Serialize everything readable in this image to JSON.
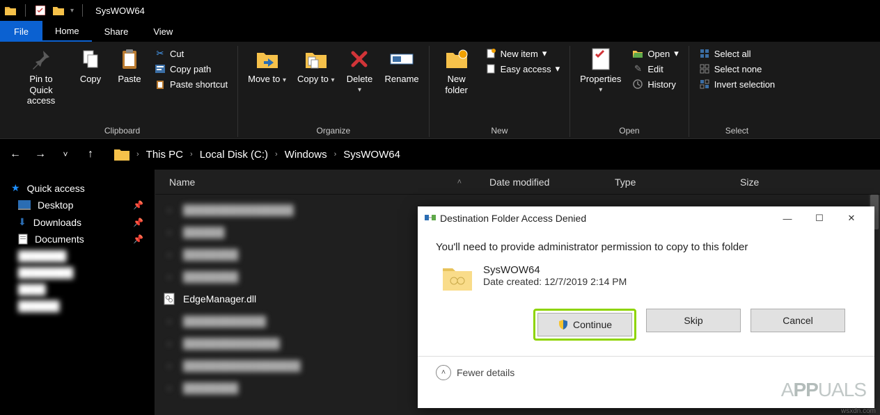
{
  "titlebar": {
    "title": "SysWOW64"
  },
  "menu": {
    "file": "File",
    "home": "Home",
    "share": "Share",
    "view": "View"
  },
  "ribbon": {
    "clipboard": {
      "label": "Clipboard",
      "pin": "Pin to Quick access",
      "copy": "Copy",
      "paste": "Paste",
      "cut": "Cut",
      "copypath": "Copy path",
      "pasteshortcut": "Paste shortcut"
    },
    "organize": {
      "label": "Organize",
      "moveto": "Move to",
      "copyto": "Copy to",
      "delete": "Delete",
      "rename": "Rename"
    },
    "new": {
      "label": "New",
      "newfolder": "New folder",
      "newitem": "New item",
      "easyaccess": "Easy access"
    },
    "open": {
      "label": "Open",
      "properties": "Properties",
      "open": "Open",
      "edit": "Edit",
      "history": "History"
    },
    "select": {
      "label": "Select",
      "all": "Select all",
      "none": "Select none",
      "invert": "Invert selection"
    }
  },
  "breadcrumb": {
    "thispc": "This PC",
    "drive": "Local Disk (C:)",
    "windows": "Windows",
    "current": "SysWOW64"
  },
  "columns": {
    "name": "Name",
    "modified": "Date modified",
    "type": "Type",
    "size": "Size"
  },
  "sidebar": {
    "quick": "Quick access",
    "desktop": "Desktop",
    "downloads": "Downloads",
    "documents": "Documents"
  },
  "files": {
    "visible": "EdgeManager.dll"
  },
  "dialog": {
    "title": "Destination Folder Access Denied",
    "message": "You'll need to provide administrator permission to copy to this folder",
    "folder_name": "SysWOW64",
    "date_label": "Date created: 12/7/2019 2:14 PM",
    "continue": "Continue",
    "skip": "Skip",
    "cancel": "Cancel",
    "fewer": "Fewer details"
  },
  "watermark": {
    "site": "wsxdn.com"
  }
}
